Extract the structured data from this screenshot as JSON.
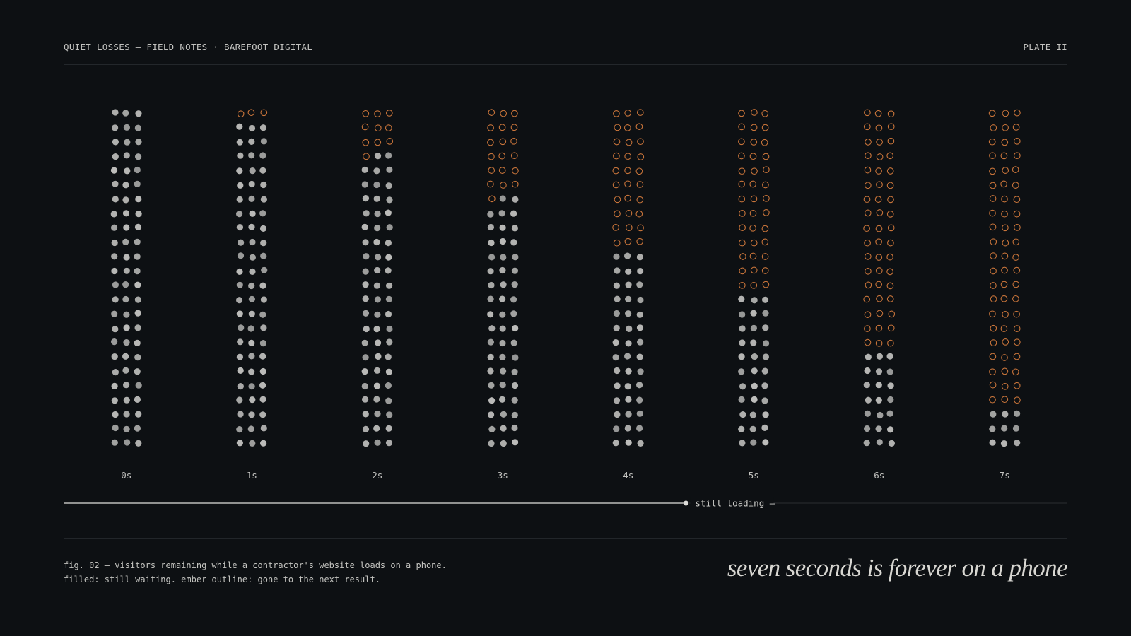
{
  "header": {
    "left": "QUIET LOSSES — FIELD NOTES · BAREFOOT DIGITAL",
    "right": "PLATE II"
  },
  "colors": {
    "background": "#0d1013",
    "waiting": "#bdbdbb",
    "gone": "#c8743a",
    "text": "#c9c9c6"
  },
  "chart_data": {
    "type": "dot-matrix",
    "x_label": "",
    "y_label": "",
    "categories": [
      "0s",
      "1s",
      "2s",
      "3s",
      "4s",
      "5s",
      "6s",
      "7s"
    ],
    "total_per_column": 72,
    "series": [
      {
        "name": "filled: still waiting",
        "values": [
          72,
          69,
          62,
          53,
          42,
          33,
          21,
          9
        ]
      },
      {
        "name": "ember outline: gone to the next result",
        "values": [
          0,
          3,
          10,
          19,
          30,
          39,
          51,
          63
        ]
      }
    ],
    "progress": {
      "label": "still loading —",
      "fraction": 0.62
    }
  },
  "caption": {
    "line1": "fig. 02 — visitors remaining while a contractor's website loads on a phone.",
    "line2": "filled: still waiting. ember outline: gone to the next result."
  },
  "tagline": "seven seconds is forever on a phone"
}
